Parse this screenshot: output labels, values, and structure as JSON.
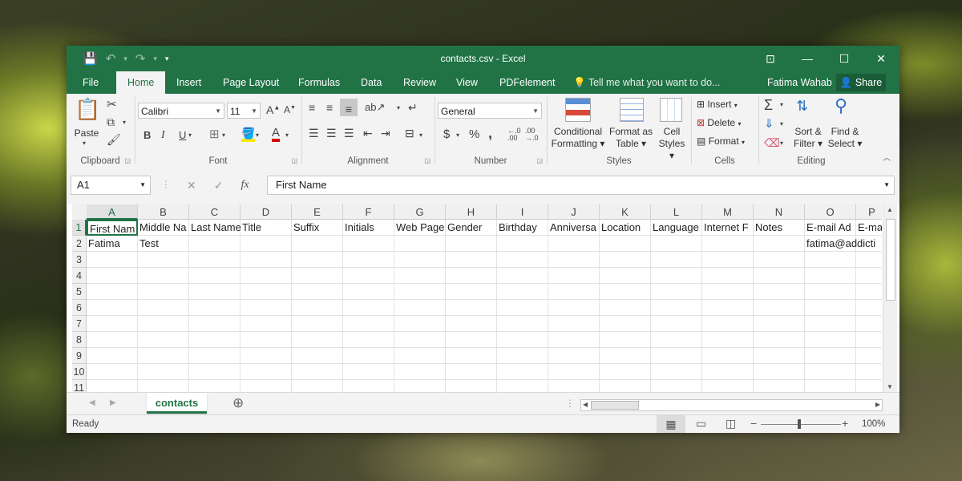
{
  "window": {
    "title": "contacts.csv - Excel"
  },
  "qat": {
    "save": "💾",
    "undo": "↶",
    "undo_dd": "▾",
    "redo": "↷",
    "redo_dd": "▾",
    "customize": "▾"
  },
  "controls": {
    "restore_ribbon": "⊡",
    "minimize": "—",
    "maximize": "☐",
    "close": "✕"
  },
  "tabs": [
    "File",
    "Home",
    "Insert",
    "Page Layout",
    "Formulas",
    "Data",
    "Review",
    "View",
    "PDFelement"
  ],
  "tell_me": "Tell me what you want to do...",
  "user": "Fatima Wahab",
  "share": "Share",
  "ribbon": {
    "clipboard": {
      "label": "Clipboard",
      "paste": "Paste"
    },
    "font": {
      "label": "Font",
      "name": "Calibri",
      "size": "11",
      "bold": "B",
      "italic": "I",
      "underline": "U"
    },
    "alignment": {
      "label": "Alignment"
    },
    "number": {
      "label": "Number",
      "format": "General",
      "currency": "$",
      "percent": "%",
      "comma": ","
    },
    "styles": {
      "label": "Styles",
      "conditional": [
        "Conditional",
        "Formatting ▾"
      ],
      "format_table": [
        "Format as",
        "Table ▾"
      ],
      "cell_styles": [
        "Cell",
        "Styles ▾"
      ]
    },
    "cells": {
      "label": "Cells",
      "insert": "Insert",
      "delete": "Delete",
      "format": "Format"
    },
    "editing": {
      "label": "Editing",
      "sort": [
        "Sort &",
        "Filter ▾"
      ],
      "find": [
        "Find &",
        "Select ▾"
      ]
    }
  },
  "formula_bar": {
    "name_box": "A1",
    "fx": "fx",
    "content": "First Name"
  },
  "grid": {
    "columns": [
      "A",
      "B",
      "C",
      "D",
      "E",
      "F",
      "G",
      "H",
      "I",
      "J",
      "K",
      "L",
      "M",
      "N",
      "O",
      "P"
    ],
    "rows": [
      "1",
      "2",
      "3",
      "4",
      "5",
      "6",
      "7",
      "8",
      "9",
      "10",
      "11"
    ],
    "row1": [
      "First Nam",
      "Middle Na",
      "Last Name",
      "Title",
      "Suffix",
      "Initials",
      "Web Page",
      "Gender",
      "Birthday",
      "Anniversa",
      "Location",
      "Language",
      "Internet F",
      "Notes",
      "E-mail Ad",
      "E-ma"
    ],
    "row2": [
      "Fatima",
      "Test",
      "",
      "",
      "",
      "",
      "",
      "",
      "",
      "",
      "",
      "",
      "",
      "",
      "fatima@addicti",
      ""
    ]
  },
  "sheet": {
    "tab": "contacts",
    "add": "⊕"
  },
  "status": {
    "ready": "Ready",
    "zoom": "100%"
  }
}
